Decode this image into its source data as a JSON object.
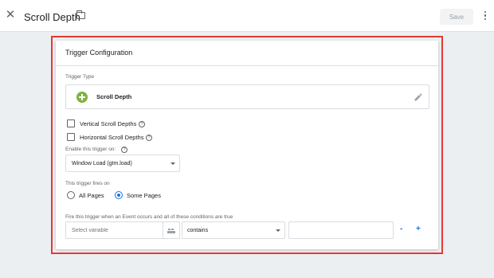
{
  "header": {
    "title": "Scroll Depth",
    "save_label": "Save",
    "close_icon": "close-icon",
    "folder_icon": "folder-icon",
    "more_icon": "more-vert-icon"
  },
  "card": {
    "title": "Trigger Configuration",
    "trigger_type_label": "Trigger Type",
    "trigger_type_name": "Scroll Depth",
    "trigger_icon_color": "#7cb342",
    "vertical_label": "Vertical Scroll Depths",
    "vertical_checked": false,
    "horizontal_label": "Horizontal Scroll Depths",
    "horizontal_checked": false,
    "enable_on_label": "Enable this trigger on:",
    "enable_on_value": "Window Load (gtm.load)",
    "fires_on_label": "This trigger fires on",
    "radio_all": "All Pages",
    "radio_some": "Some Pages",
    "selected_radio": "Some Pages",
    "conditions_label": "Fire this trigger when an Event occurs and all of these conditions are true",
    "condition": {
      "variable_placeholder": "Select variable",
      "operator": "contains",
      "value": "",
      "minus": "-",
      "plus": "+"
    }
  },
  "colors": {
    "accent": "#1a73e8",
    "highlight_frame": "#e53935"
  }
}
